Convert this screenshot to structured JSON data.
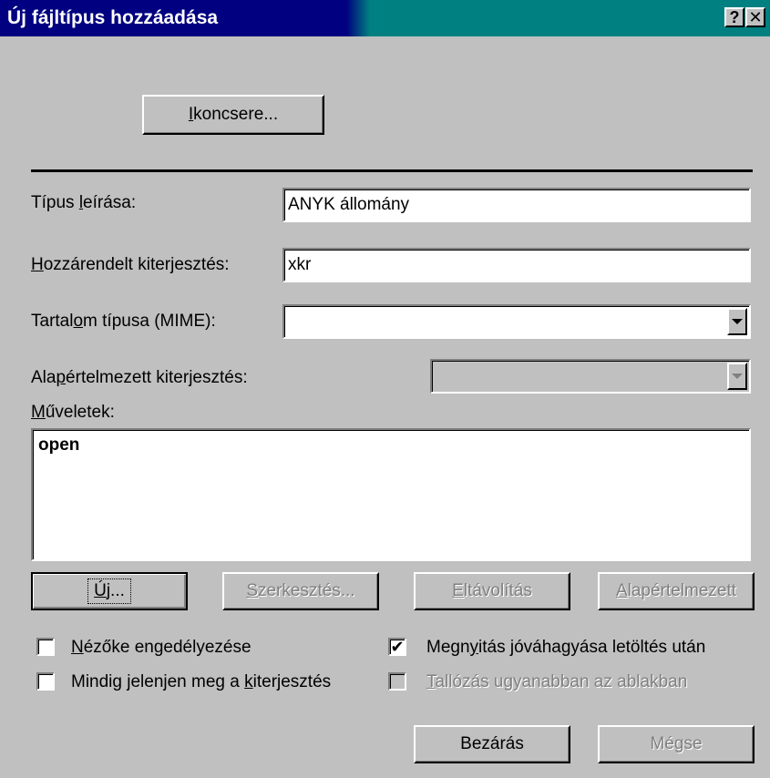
{
  "dialog": {
    "title": "Új fájltípus hozzáadása",
    "help_label": "?",
    "close_label": "✕"
  },
  "buttons": {
    "change_icon": {
      "before": "",
      "accel": "I",
      "after": "koncsere..."
    },
    "new": {
      "before": "",
      "accel": "Ú",
      "after": "j..."
    },
    "edit": {
      "before": "",
      "accel": "S",
      "after": "zerkesztés..."
    },
    "remove": {
      "before": "",
      "accel": "E",
      "after": "ltávolítás"
    },
    "set_default": {
      "before": "",
      "accel": "A",
      "after": "lapértelmezett"
    },
    "close": "Bezárás",
    "cancel": "Mégse"
  },
  "fields": {
    "description": {
      "label_before": "Típus ",
      "accel": "l",
      "label_after": "eírása:",
      "value": "ANYK állomány"
    },
    "extension": {
      "label_before": "",
      "accel": "H",
      "label_after": "ozzárendelt kiterjesztés:",
      "value": "xkr"
    },
    "mime": {
      "label_before": "Tartal",
      "accel": "o",
      "label_after": "m típusa (MIME):",
      "value": ""
    },
    "default_ext": {
      "label_before": "Ala",
      "accel": "p",
      "label_after": "értelmezett kiterjesztés:",
      "value": ""
    }
  },
  "actions": {
    "label_before": "",
    "accel": "M",
    "label_after": "űveletek:",
    "items": [
      "open"
    ]
  },
  "checkboxes": {
    "enable_viewer": {
      "before": "",
      "accel": "N",
      "after": "ézőke engedélyezése",
      "checked": false
    },
    "confirm_open": {
      "before": "Megn",
      "accel": "y",
      "after": "itás jóváhagyása letöltés után",
      "checked": true,
      "mark": "✔"
    },
    "always_show_ext": {
      "before": "Mindig jelenjen meg a ",
      "accel": "k",
      "after": "iterjesztés",
      "checked": false
    },
    "browse_same_window": {
      "before": "",
      "accel": "T",
      "after": "allózás ugyanabban az ablakban",
      "checked": false
    }
  }
}
